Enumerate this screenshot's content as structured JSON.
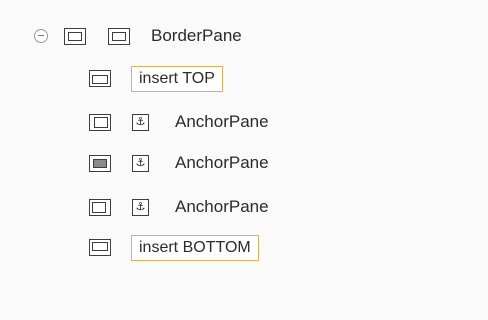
{
  "tree": {
    "root": {
      "label": "BorderPane",
      "toggle_icon": "collapse-icon",
      "icons": [
        "borderpane-structure-icon",
        "borderpane-type-icon"
      ]
    },
    "children": [
      {
        "region": "top",
        "placeholder": "insert TOP",
        "region_icon": "border-top-region-icon"
      },
      {
        "region": "left",
        "label": "AnchorPane",
        "region_icon": "border-left-region-icon",
        "type_icon": "anchor-icon"
      },
      {
        "region": "center",
        "label": "AnchorPane",
        "region_icon": "border-center-region-icon",
        "type_icon": "anchor-icon"
      },
      {
        "region": "right",
        "label": "AnchorPane",
        "region_icon": "border-right-region-icon",
        "type_icon": "anchor-icon"
      },
      {
        "region": "bottom",
        "placeholder": "insert BOTTOM",
        "region_icon": "border-bottom-region-icon"
      }
    ],
    "anchor_glyph": "⚓",
    "colors": {
      "insert_border": "#e0b060",
      "icon_stroke": "#3e3e3e",
      "center_fill": "#8a8a8a"
    }
  }
}
